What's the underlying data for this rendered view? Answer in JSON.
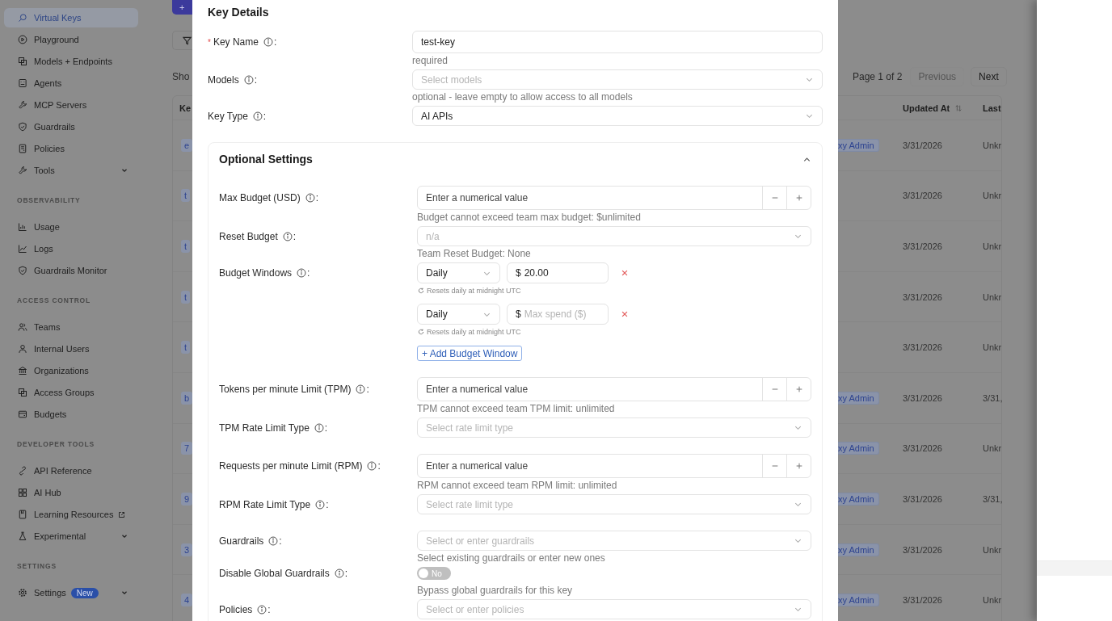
{
  "sidebar": {
    "sections": [
      {
        "items": [
          {
            "label": "Virtual Keys",
            "selected": true,
            "expandable": false,
            "external": false
          },
          {
            "label": "Playground",
            "selected": false,
            "expandable": false,
            "external": false
          },
          {
            "label": "Models + Endpoints",
            "selected": false,
            "expandable": false,
            "external": false
          },
          {
            "label": "Agents",
            "selected": false,
            "expandable": false,
            "external": false
          },
          {
            "label": "MCP Servers",
            "selected": false,
            "expandable": false,
            "external": false
          },
          {
            "label": "Guardrails",
            "selected": false,
            "expandable": false,
            "external": false
          },
          {
            "label": "Policies",
            "selected": false,
            "expandable": false,
            "external": false
          },
          {
            "label": "Tools",
            "selected": false,
            "expandable": true,
            "external": false
          }
        ]
      },
      {
        "heading": "OBSERVABILITY",
        "items": [
          {
            "label": "Usage",
            "selected": false,
            "expandable": false,
            "external": false
          },
          {
            "label": "Logs",
            "selected": false,
            "expandable": false,
            "external": false
          },
          {
            "label": "Guardrails Monitor",
            "selected": false,
            "expandable": false,
            "external": false
          }
        ]
      },
      {
        "heading": "ACCESS CONTROL",
        "items": [
          {
            "label": "Teams",
            "selected": false,
            "expandable": false,
            "external": false
          },
          {
            "label": "Internal Users",
            "selected": false,
            "expandable": false,
            "external": false
          },
          {
            "label": "Organizations",
            "selected": false,
            "expandable": false,
            "external": false
          },
          {
            "label": "Access Groups",
            "selected": false,
            "expandable": false,
            "external": false
          },
          {
            "label": "Budgets",
            "selected": false,
            "expandable": false,
            "external": false
          }
        ]
      },
      {
        "heading": "DEVELOPER TOOLS",
        "items": [
          {
            "label": "API Reference",
            "selected": false,
            "expandable": false,
            "external": false
          },
          {
            "label": "AI Hub",
            "selected": false,
            "expandable": false,
            "external": false
          },
          {
            "label": "Learning Resources",
            "selected": false,
            "expandable": false,
            "external": true
          },
          {
            "label": "Experimental",
            "selected": false,
            "expandable": true,
            "external": false
          }
        ]
      },
      {
        "heading": "SETTINGS",
        "items": [
          {
            "label": "Settings",
            "selected": false,
            "expandable": true,
            "external": false,
            "badge": "New"
          }
        ]
      }
    ]
  },
  "list_page": {
    "add_button": "+",
    "shown_fragment": "Sho",
    "key_column_fragment": "Ke",
    "key_fragments": [
      "e",
      "t",
      "t",
      "t",
      "t",
      "b",
      "7",
      "9",
      "3",
      "4"
    ],
    "pagination": {
      "text": "Page 1 of 2",
      "previous": {
        "label": "Previous",
        "disabled": true
      },
      "next": {
        "label": "Next",
        "disabled": false
      }
    },
    "columns": [
      "Updated At",
      "Last"
    ],
    "rows": [
      {
        "role": "xy Admin",
        "updated_at": "3/31/2026",
        "last": "Unkr"
      },
      {
        "updated_at": "3/31/2026",
        "last": "Unkr"
      },
      {
        "updated_at": "3/31/2026",
        "last": "Unkr"
      },
      {
        "updated_at": "3/31/2026",
        "last": "Unkr"
      },
      {
        "updated_at": "3/31/2026",
        "last": "Unkr"
      },
      {
        "role": "xy Admin",
        "updated_at": "3/31/2026",
        "last": "3/31,"
      },
      {
        "role": "xy Admin",
        "updated_at": "3/31/2026",
        "last": "Unkr"
      },
      {
        "role": "xy Admin",
        "updated_at": "3/31/2026",
        "last": "3/31,"
      },
      {
        "role": "xy Admin",
        "updated_at": "3/31/2026",
        "last": "Unkr"
      },
      {
        "role": "xy Admin",
        "updated_at": "3/31/2026",
        "last": "Unkr"
      }
    ]
  },
  "modal": {
    "title": "Key Details",
    "fields": [
      {
        "kind": "input",
        "label": "Key Name",
        "required_mark": "*",
        "colon": ":",
        "value": "test-key",
        "hint": "required"
      },
      {
        "kind": "select",
        "label": "Models",
        "colon": ":",
        "placeholder": "Select models",
        "hint": "optional - leave empty to allow access to all models"
      },
      {
        "kind": "select",
        "label": "Key Type",
        "colon": ":",
        "value": "AI APIs"
      }
    ],
    "optional_settings": {
      "title": "Optional Settings",
      "expanded": true,
      "fields": [
        {
          "kind": "number",
          "label": "Max Budget (USD)",
          "colon": ":",
          "placeholder": "Enter a numerical value",
          "hint": "Budget cannot exceed team max budget: $unlimited"
        },
        {
          "kind": "select",
          "label": "Reset Budget",
          "colon": ":",
          "placeholder": "n/a",
          "hint": "Team Reset Budget: None"
        },
        {
          "kind": "budget_windows",
          "label": "Budget Windows",
          "colon": ":",
          "windows": [
            {
              "period": "Daily",
              "currency": "$",
              "amount": "20.00",
              "note": "Resets daily at midnight UTC"
            },
            {
              "period": "Daily",
              "currency": "$",
              "placeholder": "Max spend ($)",
              "note": "Resets daily at midnight UTC"
            }
          ],
          "add_button": "+ Add Budget Window"
        },
        {
          "kind": "number",
          "label": "Tokens per minute Limit (TPM)",
          "colon": ":",
          "placeholder": "Enter a numerical value",
          "hint": "TPM cannot exceed team TPM limit: unlimited"
        },
        {
          "kind": "select",
          "label": "TPM Rate Limit Type",
          "colon": ":",
          "placeholder": "Select rate limit type"
        },
        {
          "kind": "number",
          "label": "Requests per minute Limit (RPM)",
          "colon": ":",
          "placeholder": "Enter a numerical value",
          "hint": "RPM cannot exceed team RPM limit: unlimited"
        },
        {
          "kind": "select",
          "label": "RPM Rate Limit Type",
          "colon": ":",
          "placeholder": "Select rate limit type"
        },
        {
          "kind": "select",
          "label": "Guardrails",
          "colon": ":",
          "placeholder": "Select or enter guardrails",
          "hint": "Select existing guardrails or enter new ones"
        },
        {
          "kind": "toggle",
          "label": "Disable Global Guardrails",
          "colon": ":",
          "on": false,
          "state_label": "No",
          "hint": "Bypass global guardrails for this key"
        },
        {
          "kind": "select",
          "label": "Policies",
          "colon": ":",
          "placeholder": "Select or enter policies"
        }
      ]
    }
  }
}
